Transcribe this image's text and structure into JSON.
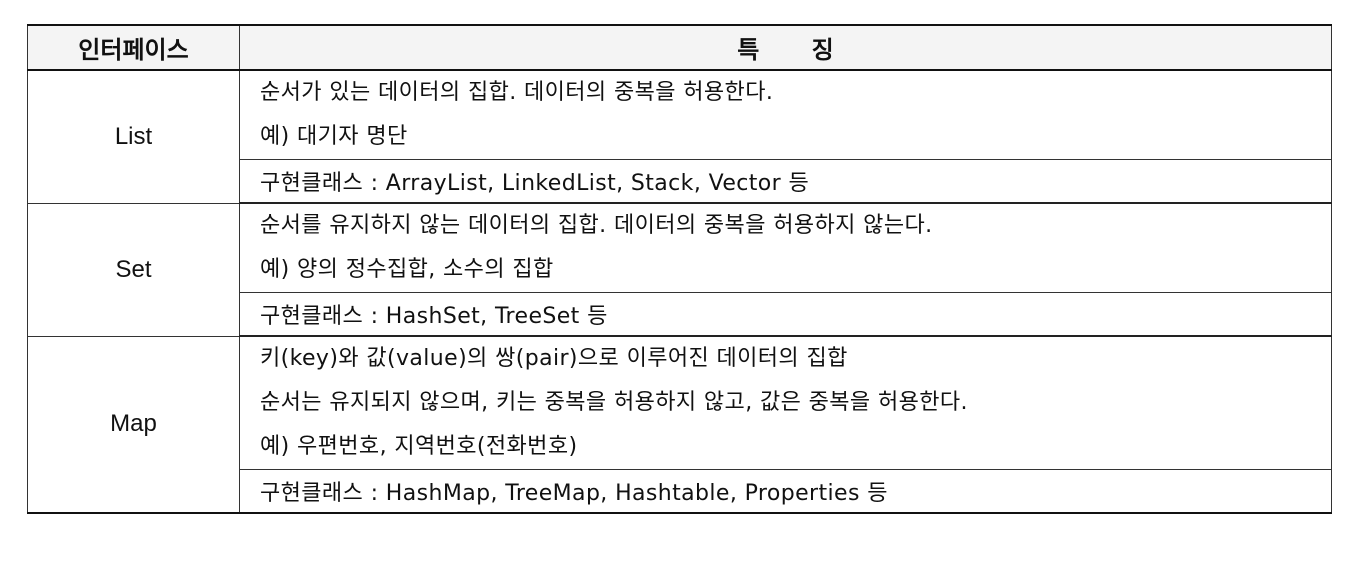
{
  "header": {
    "interface": "인터페이스",
    "feature": "특 징"
  },
  "rows": [
    {
      "name": "List",
      "desc": [
        "순서가 있는 데이터의 집합. 데이터의 중복을 허용한다.",
        "예) 대기자 명단"
      ],
      "impl": "구현클래스 : ArrayList, LinkedList, Stack, Vector 등"
    },
    {
      "name": "Set",
      "desc": [
        "순서를 유지하지 않는 데이터의 집합. 데이터의 중복을 허용하지 않는다.",
        "예) 양의 정수집합, 소수의 집합"
      ],
      "impl": "구현클래스 : HashSet, TreeSet 등"
    },
    {
      "name": "Map",
      "desc": [
        "키(key)와 값(value)의 쌍(pair)으로 이루어진 데이터의 집합",
        "순서는 유지되지 않으며, 키는 중복을 허용하지 않고, 값은 중복을 허용한다.",
        "예) 우편번호, 지역번호(전화번호)"
      ],
      "impl": "구현클래스 : HashMap, TreeMap, Hashtable, Properties 등"
    }
  ]
}
